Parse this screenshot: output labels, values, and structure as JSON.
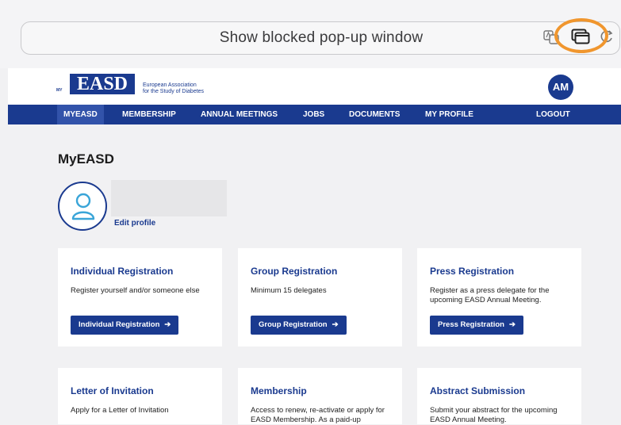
{
  "browser": {
    "popup_message": "Show blocked pop-up window"
  },
  "header": {
    "logo_my": "MY",
    "logo": "EASD",
    "org_line1": "European Association",
    "org_line2": "for the Study of Diabetes",
    "avatar_initials": "AM"
  },
  "nav": {
    "items": [
      {
        "label": "MYEASD"
      },
      {
        "label": "MEMBERSHIP"
      },
      {
        "label": "ANNUAL MEETINGS"
      },
      {
        "label": "JOBS"
      },
      {
        "label": "DOCUMENTS"
      },
      {
        "label": "MY PROFILE"
      },
      {
        "label": "LOGOUT"
      }
    ]
  },
  "page": {
    "title": "MyEASD",
    "edit_profile": "Edit profile"
  },
  "cards": [
    {
      "title": "Individual Registration",
      "desc": "Register yourself and/or someone else",
      "button": "Individual Registration"
    },
    {
      "title": "Group Registration",
      "desc": "Minimum 15 delegates",
      "button": "Group Registration"
    },
    {
      "title": "Press Registration",
      "desc": "Register as a press delegate for the upcoming EASD Annual Meeting.",
      "button": "Press Registration"
    },
    {
      "title": "Letter of Invitation",
      "desc": "Apply for a Letter of Invitation"
    },
    {
      "title": "Membership",
      "desc": "Access to renew, re-activate or apply for EASD Membership. As a paid-up"
    },
    {
      "title": "Abstract Submission",
      "desc": "Submit your abstract for the upcoming EASD Annual Meeting."
    }
  ],
  "colors": {
    "brand": "#1a3a8f",
    "highlight": "#f0962e"
  }
}
